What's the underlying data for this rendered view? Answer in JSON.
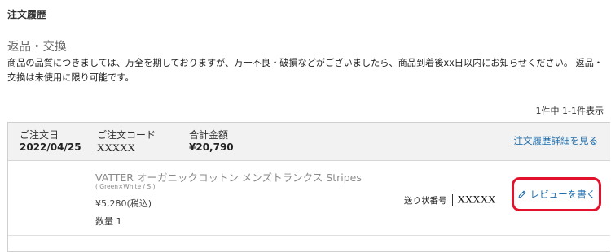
{
  "page": {
    "title": "注文履歴",
    "section_title": "返品・交換",
    "notice": "商品の品質につきましては、万全を期しておりますが、万一不良・破損などがございましたら、商品到着後xx日以内にお知らせください。 返品・交換は未使用に限り可能です。",
    "result_count": "1件中 1-1件表示"
  },
  "order": {
    "date_label": "ご注文日",
    "date_value": "2022/04/25",
    "code_label": "ご注文コード",
    "code_value": "XXXXX",
    "total_label": "合計金額",
    "total_value": "¥20,790",
    "detail_link": "注文履歴詳細を見る",
    "item": {
      "name": "VATTER オーガニックコットン メンズトランクス Stripes",
      "variant": "( Green×White / S )",
      "price": "¥5,280(税込)",
      "quantity": "数量 1",
      "tracking_label": "送り状番号",
      "tracking_value": "XXXXX",
      "review_button": "レビューを書く"
    }
  },
  "colors": {
    "link": "#1f6dab",
    "highlight_border": "#e2112c",
    "header_bg": "#f2f2f2"
  },
  "icons": {
    "review": "pencil-icon"
  }
}
